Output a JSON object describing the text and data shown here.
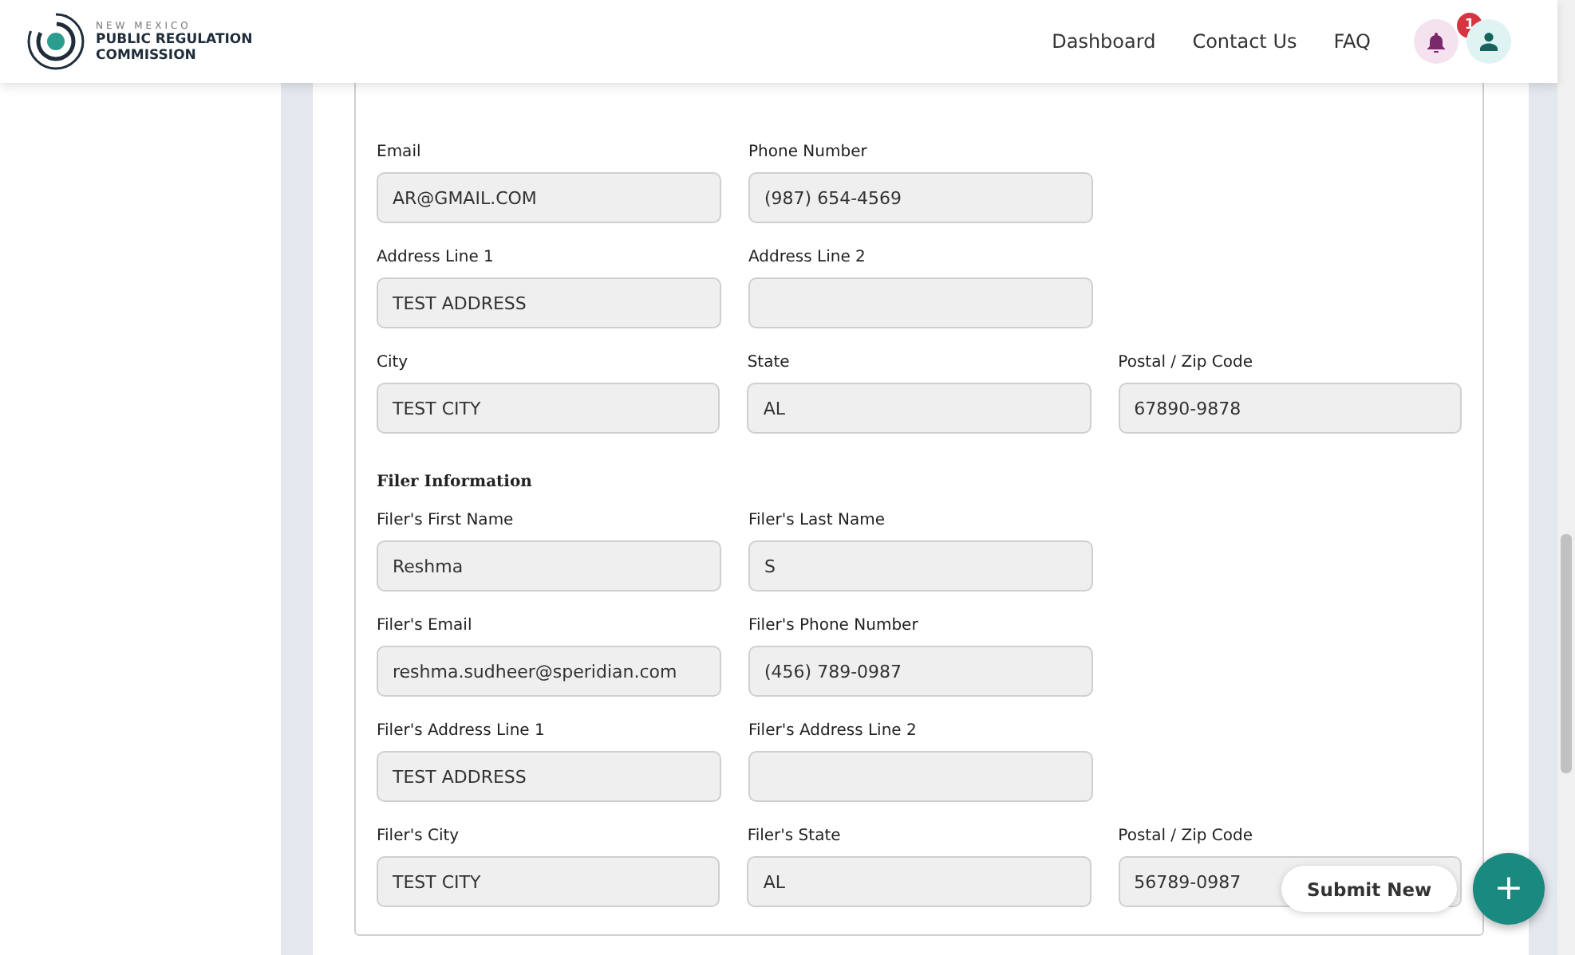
{
  "header": {
    "logo": {
      "line_1": "NEW MEXICO",
      "line_2": "PUBLIC REGULATION",
      "line_3": "COMMISSION"
    },
    "nav": [
      "Dashboard",
      "Contact Us",
      "FAQ"
    ],
    "notifications": {
      "count": "1"
    }
  },
  "sections": [
    {
      "rows": [
        [
          {
            "label": "Email",
            "value": "AR@GMAIL.COM"
          },
          {
            "label": "Phone Number",
            "value": "(987) 654-4569"
          }
        ],
        [
          {
            "label": "Address Line 1",
            "value": "TEST ADDRESS"
          },
          {
            "label": "Address Line 2"
          }
        ],
        [
          {
            "label": "City",
            "value": "TEST CITY"
          },
          {
            "label": "State",
            "value": "AL"
          },
          {
            "label": "Postal / Zip Code",
            "value": "67890-9878"
          }
        ]
      ]
    },
    {
      "heading": "Filer Information",
      "rows": [
        [
          {
            "label": "Filer's First Name",
            "value": "Reshma"
          },
          {
            "label": "Filer's Last Name",
            "value": "S"
          }
        ],
        [
          {
            "label": "Filer's Email",
            "value": "reshma.sudheer@speridian.com"
          },
          {
            "label": "Filer's Phone Number",
            "value": "(456) 789-0987"
          }
        ],
        [
          {
            "label": "Filer's Address Line 1",
            "value": "TEST ADDRESS"
          },
          {
            "label": "Filer's Address Line 2"
          }
        ],
        [
          {
            "label": "Filer's City",
            "value": "TEST CITY"
          },
          {
            "label": "Filer's State",
            "value": "AL"
          },
          {
            "label": "Postal / Zip Code",
            "value": "56789-0987"
          }
        ]
      ]
    }
  ],
  "actions": {
    "submit_label": "Submit New",
    "fab_symbol": "+"
  }
}
